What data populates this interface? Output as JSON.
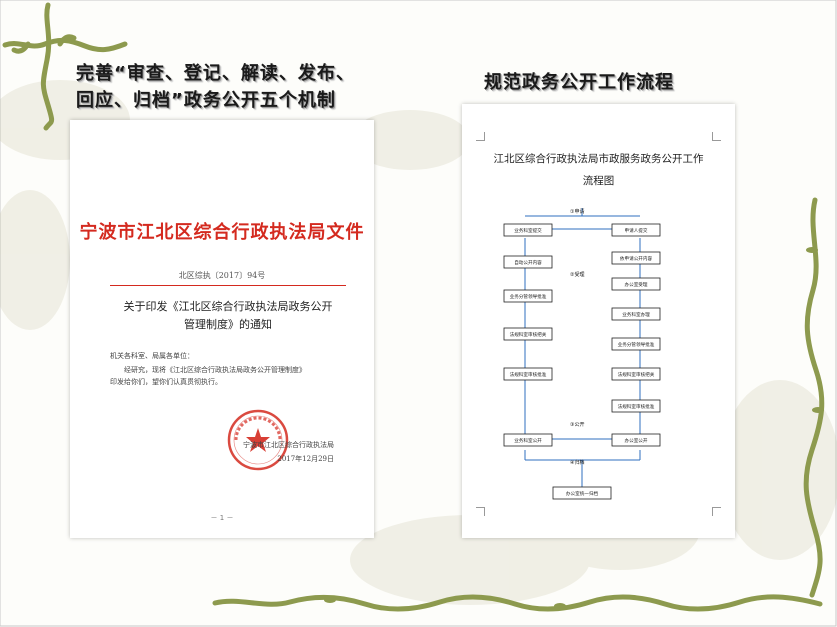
{
  "heading_left": [
    "完善“审查、登记、解读、发布、",
    "回应、归档”政务公开五个机制"
  ],
  "heading_right": "规范政务公开工作流程",
  "left_doc": {
    "red_header": "宁波市江北区综合行政执法局文件",
    "doc_number": "北区综执〔2017〕94号",
    "notice_title": [
      "关于印发《江北区综合行政执法局政务公开",
      "管理制度》的通知"
    ],
    "salutation": "机关各科室、局属各单位：",
    "body_lines": [
      "经研究，现将《江北区综合行政执法局政务公开管理制度》",
      "印发给你们，望你们认真贯彻执行。"
    ],
    "signature_org": "宁波市江北区综合行政执法局",
    "signature_date": "2017年12月29日",
    "seal_text": "宁波市江北区综合行政执法局",
    "page_number": "－ 1 －",
    "brand_red": "#d42a1f"
  },
  "right_doc": {
    "title_lines": [
      "江北区综合行政执法局市政服务政务公开工作",
      "流程图"
    ],
    "stages": [
      "①申请",
      "②受理",
      "③公开",
      "④归档"
    ],
    "boxes": {
      "left_col": [
        "业务科室提交",
        "自动公开内容",
        "业务分管领导批准",
        "法规科室审核把关",
        "法规科室审核批准",
        "业务科室公开"
      ],
      "right_col": [
        "申请人提交",
        "依申请公开内容",
        "办公室受理",
        "业务科室办理",
        "业务分管领导批准",
        "法规科室审核把关",
        "法规科室审核批准",
        "办公室公开"
      ],
      "final": "办公室统一归档"
    }
  },
  "colors": {
    "vine": "#8d9a4e",
    "flow_line": "#2f6fbf",
    "heading_shadow": "#9a9a9a"
  }
}
